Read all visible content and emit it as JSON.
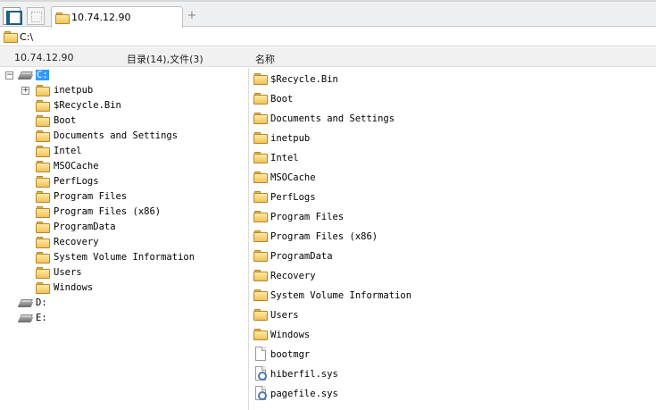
{
  "tab": {
    "label": "10.74.12.90"
  },
  "pathbar": {
    "path": "C:\\"
  },
  "header": {
    "host": "10.74.12.90",
    "counts": "目录(14),文件(3)",
    "name_col": "名称"
  },
  "tree": {
    "drive_c": "C:",
    "folders": [
      "inetpub",
      "$Recycle.Bin",
      "Boot",
      "Documents and Settings",
      "Intel",
      "MSOCache",
      "PerfLogs",
      "Program Files",
      "Program Files (x86)",
      "ProgramData",
      "Recovery",
      "System Volume Information",
      "Users",
      "Windows"
    ],
    "drive_d": "D:",
    "drive_e": "E:",
    "expander_symbol": "+",
    "collapse_symbol": "−"
  },
  "list": {
    "folders": [
      "$Recycle.Bin",
      "Boot",
      "Documents and Settings",
      "inetpub",
      "Intel",
      "MSOCache",
      "PerfLogs",
      "Program Files",
      "Program Files (x86)",
      "ProgramData",
      "Recovery",
      "System Volume Information",
      "Users",
      "Windows"
    ],
    "files": [
      "bootmgr",
      "hiberfil.sys",
      "pagefile.sys"
    ]
  },
  "icons": {
    "tab_plus": "+",
    "folder": "folder-icon",
    "drive": "drive-icon",
    "file": "file-icon",
    "system_file": "system-file-icon"
  },
  "colors": {
    "selection": "#3399ff",
    "folder": "#f0c35a"
  }
}
